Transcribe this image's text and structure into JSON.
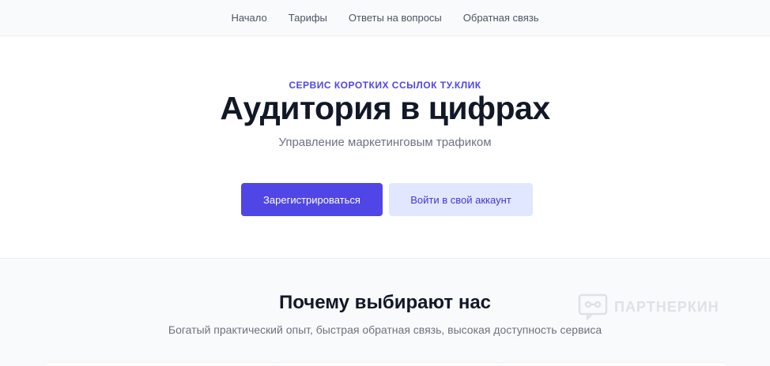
{
  "nav": {
    "items": [
      "Начало",
      "Тарифы",
      "Ответы на вопросы",
      "Обратная связь"
    ]
  },
  "hero": {
    "eyebrow": "СЕРВИС КОРОТКИХ ССЫЛОК ТУ.КЛИК",
    "title": "Аудитория в цифрах",
    "subtitle": "Управление маркетинговым трафиком",
    "register_label": "Зарегистрироваться",
    "login_label": "Войти в свой аккаунт"
  },
  "features": {
    "title": "Почему выбирают нас",
    "subtitle": "Богатый практический опыт, быстрая обратная связь, высокая доступность сервиса"
  },
  "watermark": {
    "text": "ПАРТНЕРКИН"
  },
  "colors": {
    "accent": "#4f46e5",
    "accent_light": "#e0e7ff"
  }
}
